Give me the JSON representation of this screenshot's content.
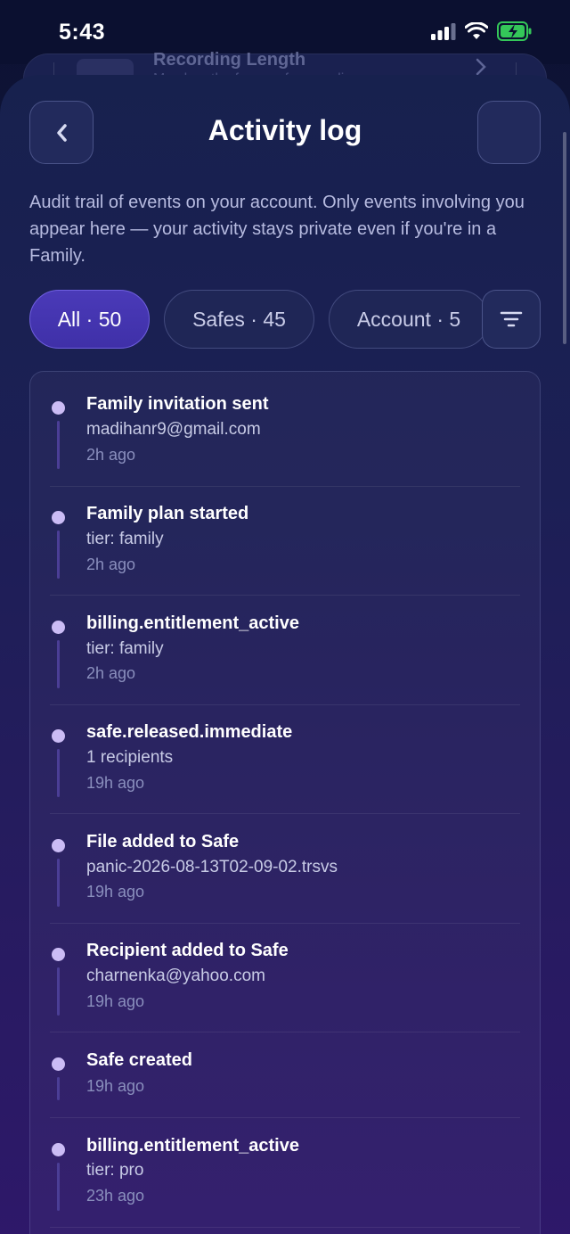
{
  "status_bar": {
    "time": "5:43"
  },
  "background_sheet": {
    "title": "Recording Length",
    "subtitle": "Max length of any safe recording"
  },
  "header": {
    "title": "Activity log"
  },
  "description": "Audit trail of events on your account. Only events involving you appear here — your activity stays private even if you're in a Family.",
  "filters": {
    "all": "All · 50",
    "safes": "Safes · 45",
    "account": "Account · 5",
    "selected": "all"
  },
  "events": [
    {
      "title": "Family invitation sent",
      "detail": "madihanr9@gmail.com",
      "time": "2h ago"
    },
    {
      "title": "Family plan started",
      "detail": "tier: family",
      "time": "2h ago"
    },
    {
      "title": "billing.entitlement_active",
      "detail": "tier: family",
      "time": "2h ago"
    },
    {
      "title": "safe.released.immediate",
      "detail": "1 recipients",
      "time": "19h ago"
    },
    {
      "title": "File added to Safe",
      "detail": "panic-2026-08-13T02-09-02.trsvs",
      "time": "19h ago"
    },
    {
      "title": "Recipient added to Safe",
      "detail": "charnenka@yahoo.com",
      "time": "19h ago"
    },
    {
      "title": "Safe created",
      "detail": "",
      "time": "19h ago"
    },
    {
      "title": "billing.entitlement_active",
      "detail": "tier: pro",
      "time": "23h ago"
    }
  ],
  "colors": {
    "accent": "#4a3ab8",
    "timeline_dot": "#cbbcf5",
    "timeline_line": "#4b3e96"
  }
}
